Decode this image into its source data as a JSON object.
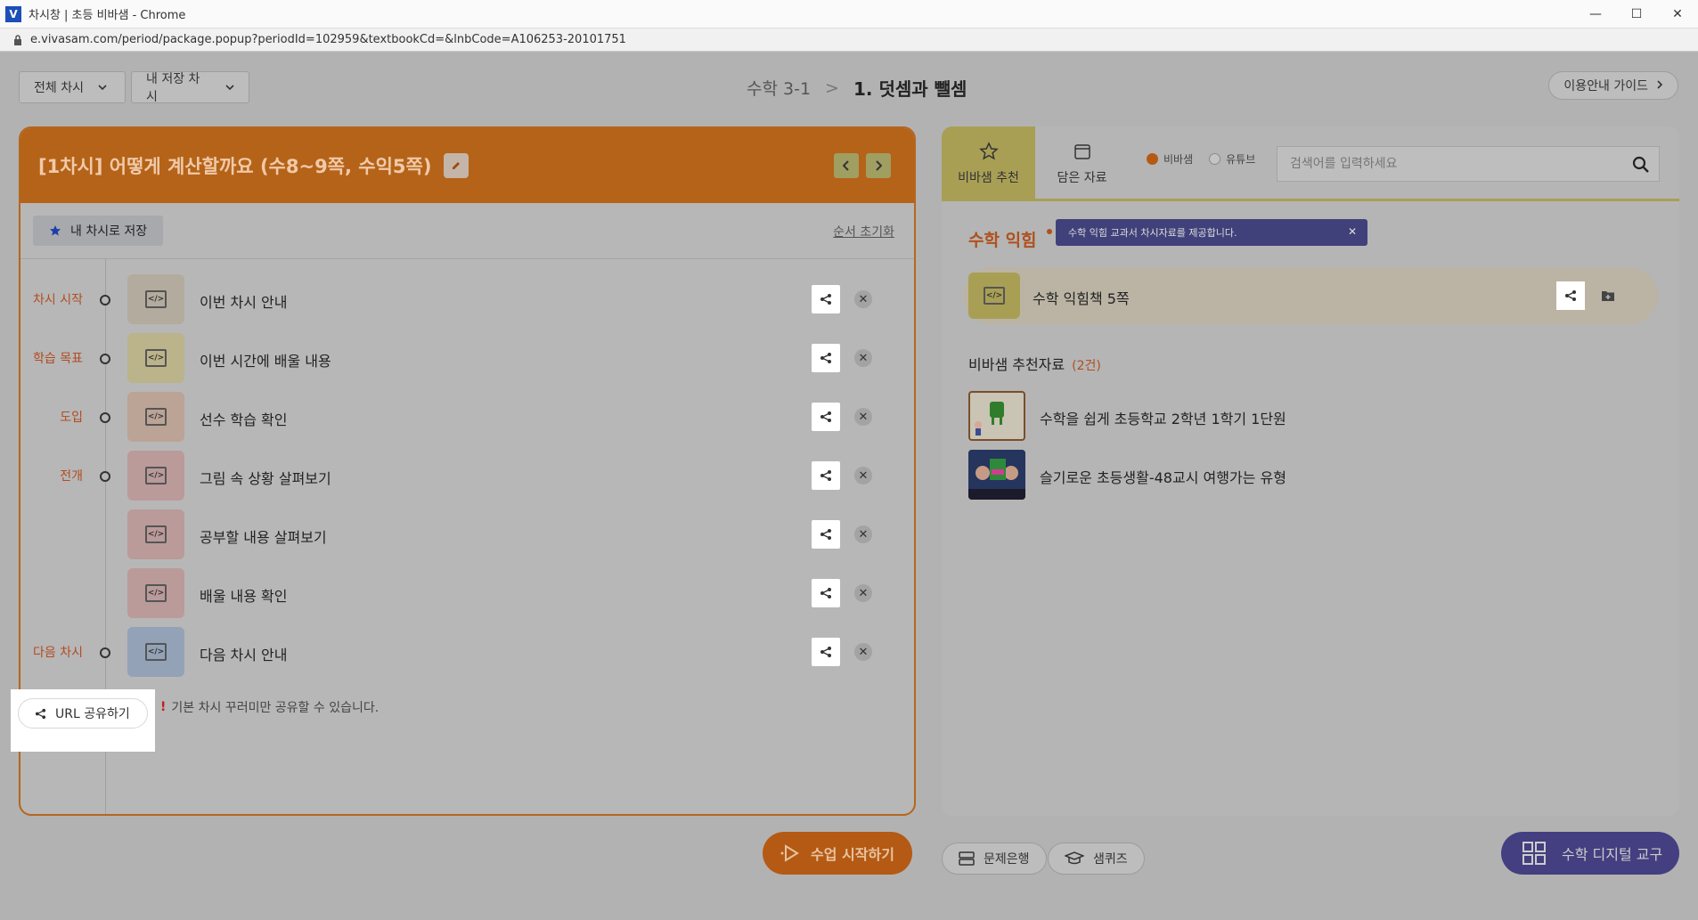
{
  "window": {
    "app_icon_letter": "V",
    "title": "차시창 | 초등 비바샘 - Chrome",
    "url": "e.vivasam.com/period/package.popup?periodId=102959&textbookCd=&lnbCode=A106253-20101751",
    "controls": [
      "—",
      "☐",
      "✕"
    ]
  },
  "toolbar": {
    "all_periods": "전체 차시",
    "my_periods": "내 저장 차시",
    "breadcrumb_subject": "수학 3-1",
    "breadcrumb_separator": ">",
    "breadcrumb_unit": "1. 덧셈과 뺄셈",
    "guide_label": "이용안내 가이드"
  },
  "lesson": {
    "title": "[1차시] 어떻게 계산할까요 (수8~9쪽, 수익5쪽)",
    "save_label": "내 차시로 저장",
    "reset_label": "순서 초기화",
    "rows": [
      {
        "stage": "차시 시작",
        "label": "이번 차시 안내",
        "thumb_color": "#b3ab9d"
      },
      {
        "stage": "학습 목표",
        "label": "이번 시간에 배울 내용",
        "thumb_color": "#bbb38a"
      },
      {
        "stage": "도입",
        "label": "선수 학습 확인",
        "thumb_color": "#bba396"
      },
      {
        "stage": "전개",
        "label": "그림 속 상황 살펴보기",
        "thumb_color": "#bb9a9a"
      },
      {
        "stage": "",
        "label": "공부할 내용 살펴보기",
        "thumb_color": "#bb9a9a"
      },
      {
        "stage": "",
        "label": "배울 내용 확인",
        "thumb_color": "#bb9a9a"
      },
      {
        "stage": "다음 차시",
        "label": "다음 차시 안내",
        "thumb_color": "#93a2b6"
      }
    ]
  },
  "resources": {
    "tab_recommend": "비바샘 추천",
    "tab_saved": "담은 자료",
    "radio_vivasam": "비바샘",
    "radio_youtube": "유튜브",
    "search_placeholder": "검색어를 입력하세요",
    "section_title": "수학 익힘",
    "tooltip": "수학 익힘 교과서 차시자료를 제공합니다.",
    "featured_label": "수학 익힘책 5쪽",
    "rec_title": "비바샘 추천자료",
    "rec_count": "(2건)",
    "rec_items": [
      {
        "label": "수학을 쉽게 초등학교 2학년 1학기 1단원"
      },
      {
        "label": "슬기로운 초등생활-48교시 여행가는 유형"
      }
    ]
  },
  "bottom": {
    "url_share": "URL 공유하기",
    "share_note_mark": "!",
    "share_note": "기본 차시 꾸러미만 공유할 수 있습니다.",
    "start_class": "수업 시작하기",
    "question_bank": "문제은행",
    "sam_quiz": "샘퀴즈",
    "digital_tool": "수학 디지털 교구"
  },
  "colors": {
    "accent_orange": "#b56318",
    "tab_active": "#a89f55",
    "digital_btn": "#433f80"
  }
}
